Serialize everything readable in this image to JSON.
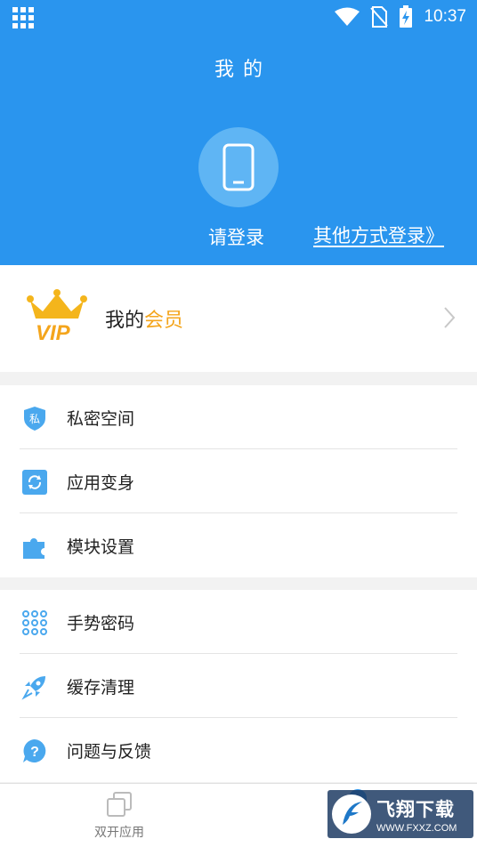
{
  "status_bar": {
    "time": "10:37"
  },
  "header": {
    "title": "我的",
    "login_label": "请登录",
    "other_login_label": "其他方式登录》"
  },
  "vip": {
    "badge_text": "VIP",
    "label_prefix": "我的",
    "label_highlight": "会员"
  },
  "menu_groups": [
    {
      "items": [
        {
          "label": "私密空间",
          "icon": "private-space-shield-icon",
          "icon_text": "私"
        },
        {
          "label": "应用变身",
          "icon": "app-transform-icon"
        },
        {
          "label": "模块设置",
          "icon": "puzzle-module-icon"
        }
      ]
    },
    {
      "items": [
        {
          "label": "手势密码",
          "icon": "gesture-pattern-icon"
        },
        {
          "label": "缓存清理",
          "icon": "rocket-clean-icon"
        },
        {
          "label": "问题与反馈",
          "icon": "question-feedback-icon"
        }
      ]
    }
  ],
  "bottom_nav": {
    "dual_apps_label": "双开应用"
  },
  "watermark": {
    "title": "飞翔下载",
    "url": "WWW.FXXZ.COM"
  },
  "colors": {
    "brand_blue": "#2a95ee",
    "vip_gold": "#f4a51c",
    "icon_blue": "#4aa8ee"
  }
}
